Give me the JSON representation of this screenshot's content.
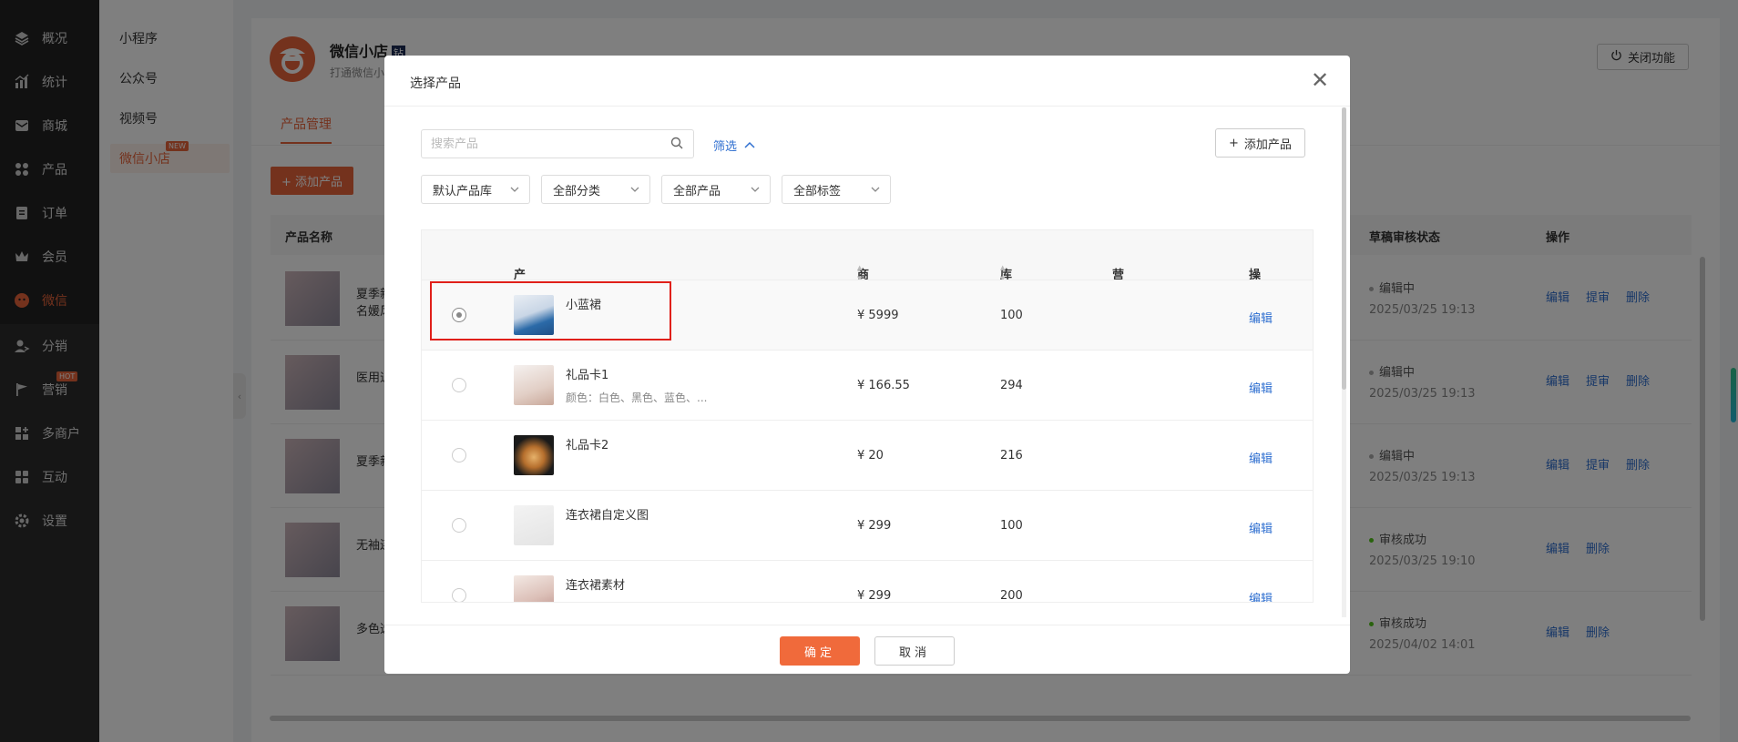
{
  "sidebar": {
    "items": [
      {
        "label": "概况",
        "icon": "layers-icon"
      },
      {
        "label": "统计",
        "icon": "chart-icon"
      },
      {
        "label": "商城",
        "icon": "mail-icon"
      },
      {
        "label": "产品",
        "icon": "grid-icon"
      },
      {
        "label": "订单",
        "icon": "clipboard-icon"
      },
      {
        "label": "会员",
        "icon": "crown-icon"
      },
      {
        "label": "微信",
        "icon": "wechat-icon"
      },
      {
        "label": "分销",
        "icon": "user-share-icon"
      },
      {
        "label": "营销",
        "icon": "flag-icon"
      },
      {
        "label": "多商户",
        "icon": "store-icon"
      },
      {
        "label": "互动",
        "icon": "apps-icon"
      },
      {
        "label": "设置",
        "icon": "gear-icon"
      }
    ],
    "hot_badge": "HOT"
  },
  "submenu": {
    "items": [
      "小程序",
      "公众号",
      "视频号",
      "微信小店"
    ],
    "new_badge": "NEW"
  },
  "shop": {
    "title": "微信小店",
    "tag": "钻",
    "desc": "打通微信小",
    "close_label": "关闭功能"
  },
  "tabs": {
    "active": "产品管理"
  },
  "bg_table": {
    "add_label": "+ 添加产品",
    "col_name": "产品名称",
    "col_status": "草稿审核状态",
    "col_actions": "操作",
    "rows": [
      {
        "name": "夏季新",
        "name2": "名媛风",
        "status": "编辑中",
        "time": "2025/03/25 19:13",
        "acts": [
          "编辑",
          "提审",
          "删除"
        ],
        "ok": false
      },
      {
        "name": "医用退",
        "name2": "",
        "status": "编辑中",
        "time": "2025/03/25 19:13",
        "acts": [
          "编辑",
          "提审",
          "删除"
        ],
        "ok": false
      },
      {
        "name": "夏季新",
        "name2": "",
        "status": "编辑中",
        "time": "2025/03/25 19:13",
        "acts": [
          "编辑",
          "提审",
          "删除"
        ],
        "ok": false
      },
      {
        "name": "无袖连",
        "name2": "",
        "status": "审核成功",
        "time": "2025/03/25 19:10",
        "acts": [
          "编辑",
          "删除"
        ],
        "ok": true
      },
      {
        "name": "多色选",
        "name2": "",
        "status": "审核成功",
        "time": "2025/04/02 14:01",
        "acts": [
          "编辑",
          "删除"
        ],
        "ok": true
      }
    ]
  },
  "modal": {
    "title": "选择产品",
    "search_placeholder": "搜索产品",
    "filter_label": "筛选",
    "add_label": "添加产品",
    "selects": [
      "默认产品库",
      "全部分类",
      "全部产品",
      "全部标签"
    ],
    "columns": {
      "product": "产品",
      "price": "商城价",
      "stock": "库存",
      "promo": "营销活动",
      "actions": "操作"
    },
    "rows": [
      {
        "name": "小蓝裙",
        "spec": "",
        "price": "¥ 5999",
        "stock": "100",
        "edit": "编辑",
        "selected": true
      },
      {
        "name": "礼品卡1",
        "spec": "颜色：白色、黑色、蓝色、...",
        "price": "¥ 166.55",
        "stock": "294",
        "edit": "编辑",
        "selected": false
      },
      {
        "name": "礼品卡2",
        "spec": "",
        "price": "¥ 20",
        "stock": "216",
        "edit": "编辑",
        "selected": false
      },
      {
        "name": "连衣裙自定义图",
        "spec": "",
        "price": "¥ 299",
        "stock": "100",
        "edit": "编辑",
        "selected": false
      },
      {
        "name": "连衣裙素材",
        "spec": "",
        "price": "¥ 299",
        "stock": "200",
        "edit": "编辑",
        "selected": false
      }
    ],
    "ok_label": "确定",
    "cancel_label": "取消"
  },
  "colors": {
    "accent": "#e8643b",
    "link": "#2f6fd0",
    "highlight": "#e0201a"
  }
}
